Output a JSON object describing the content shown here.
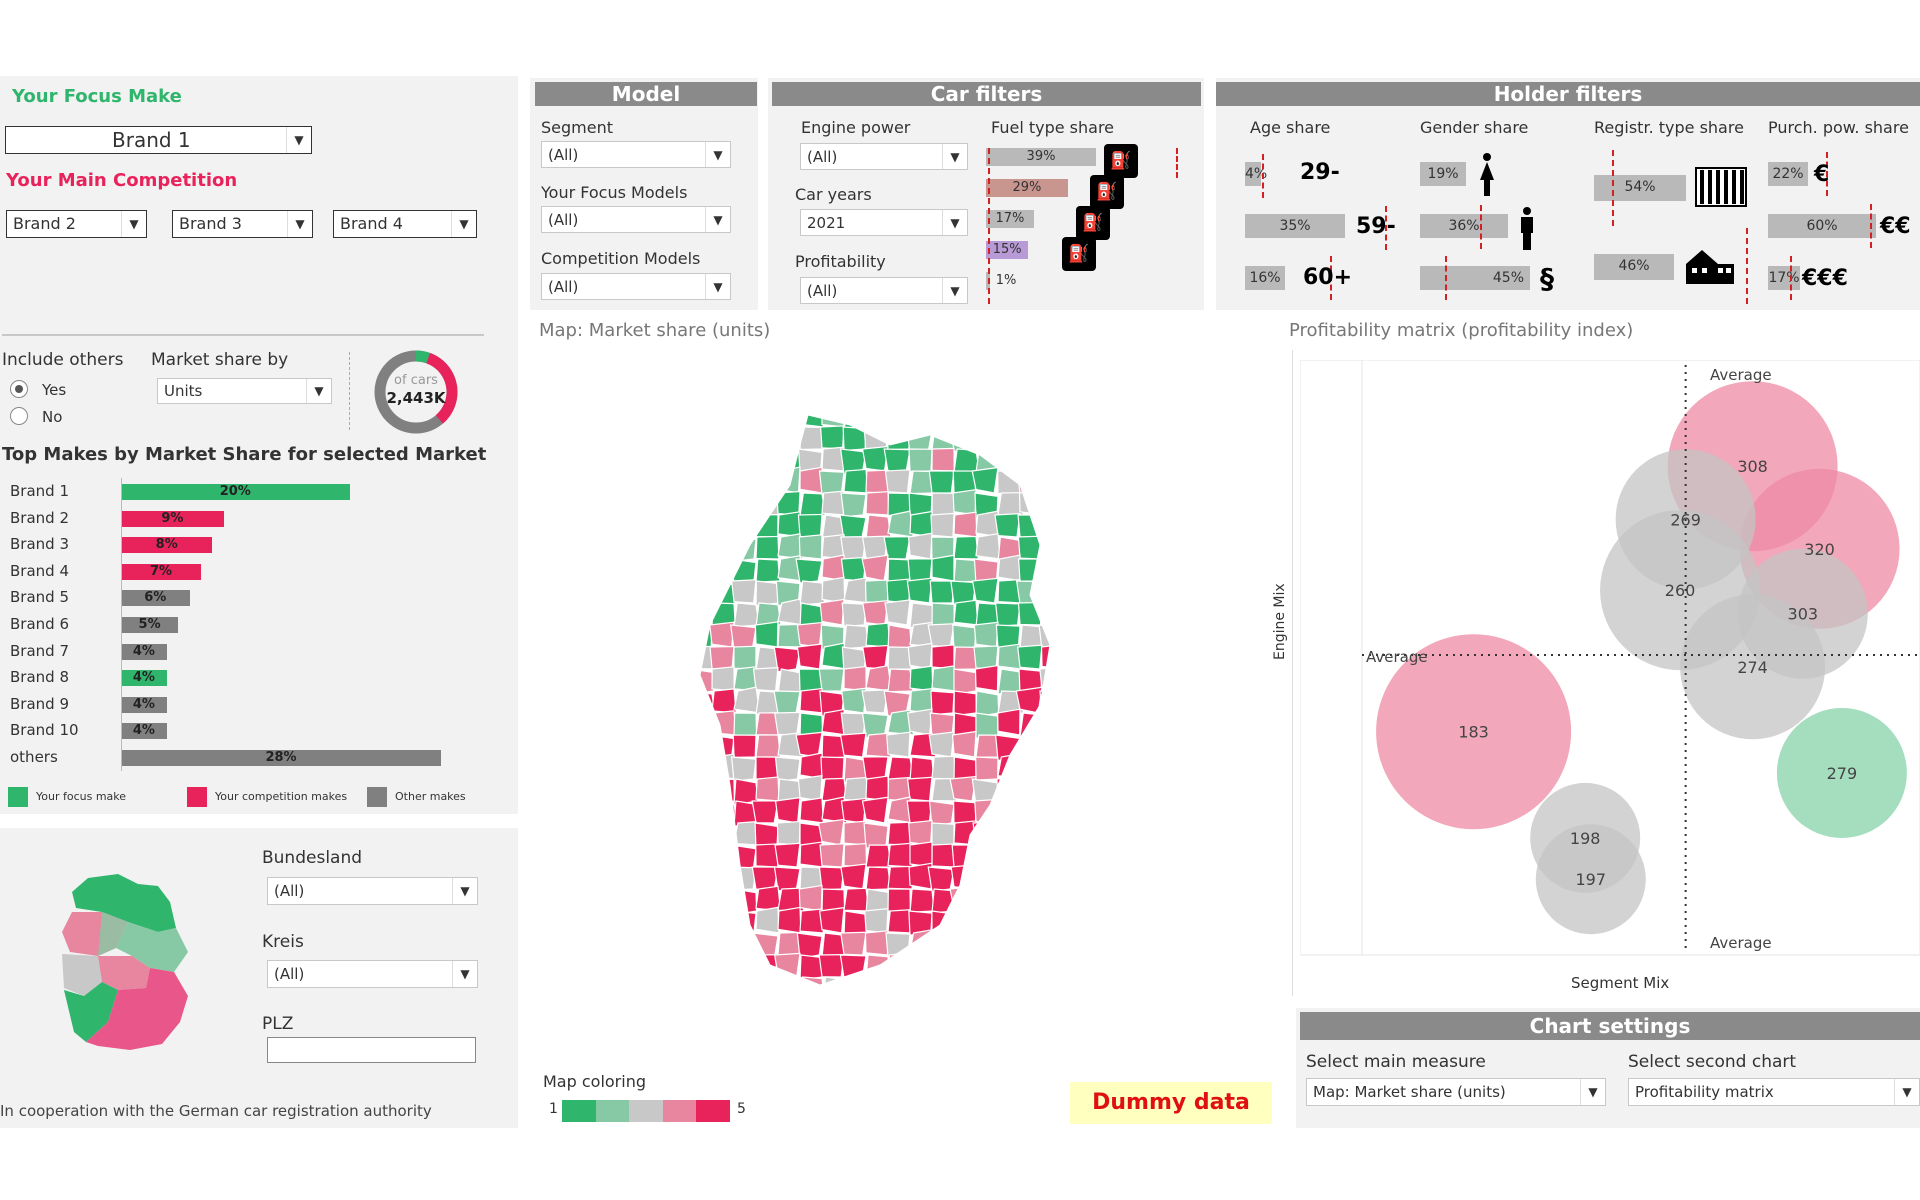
{
  "colors": {
    "focus": "#2fb56c",
    "competition": "#e8235c",
    "other": "#808080",
    "pink": "#e8859f",
    "lightgreen": "#86c9a4",
    "grey": "#c8c8c8"
  },
  "left": {
    "focus_make_label": "Your Focus Make",
    "focus_make_value": "Brand 1",
    "competition_label": "Your Main Competition",
    "competitors": [
      "Brand 2",
      "Brand 3",
      "Brand 4"
    ],
    "include_others_label": "Include others",
    "include_yes": "Yes",
    "include_no": "No",
    "market_share_by_label": "Market share by",
    "market_share_by_value": "Units",
    "donut_line1": "of cars",
    "donut_line2": "2,443K",
    "top_makes_title": "Top Makes by Market Share for selected Market",
    "legend": {
      "focus": "Your focus make",
      "competition": "Your competition makes",
      "other": "Other makes"
    },
    "bundesland_label": "Bundesland",
    "bundesland_value": "(All)",
    "kreis_label": "Kreis",
    "kreis_value": "(All)",
    "plz_label": "PLZ",
    "plz_value": "",
    "footer": "In cooperation with the German car registration authority"
  },
  "top_makes": [
    {
      "name": "Brand 1",
      "pct": 20,
      "label": "20%",
      "group": "focus"
    },
    {
      "name": "Brand 2",
      "pct": 9,
      "label": "9%",
      "group": "competition"
    },
    {
      "name": "Brand 3",
      "pct": 8,
      "label": "8%",
      "group": "competition"
    },
    {
      "name": "Brand 4",
      "pct": 7,
      "label": "7%",
      "group": "competition"
    },
    {
      "name": "Brand 5",
      "pct": 6,
      "label": "6%",
      "group": "other"
    },
    {
      "name": "Brand 6",
      "pct": 5,
      "label": "5%",
      "group": "other"
    },
    {
      "name": "Brand 7",
      "pct": 4,
      "label": "4%",
      "group": "other"
    },
    {
      "name": "Brand 8",
      "pct": 4,
      "label": "4%",
      "group": "focus"
    },
    {
      "name": "Brand 9",
      "pct": 4,
      "label": "4%",
      "group": "other"
    },
    {
      "name": "Brand 10",
      "pct": 4,
      "label": "4%",
      "group": "other"
    },
    {
      "name": "others",
      "pct": 28,
      "label": "28%",
      "group": "other"
    }
  ],
  "model": {
    "title": "Model",
    "segment_label": "Segment",
    "segment_value": "(All)",
    "focus_models_label": "Your Focus Models",
    "focus_models_value": "(All)",
    "competition_models_label": "Competition Models",
    "competition_models_value": "(All)"
  },
  "car_filters": {
    "title": "Car filters",
    "engine_power_label": "Engine power",
    "engine_power_value": "(All)",
    "car_years_label": "Car years",
    "car_years_value": "2021",
    "profitability_label": "Profitability",
    "profitability_value": "(All)",
    "fuel_label": "Fuel type share",
    "fuel": [
      {
        "pct": 39,
        "label": "39%",
        "icon": "G",
        "color": "#b9b9b9"
      },
      {
        "pct": 29,
        "label": "29%",
        "icon": "H",
        "color": "#c9958f"
      },
      {
        "pct": 17,
        "label": "17%",
        "icon": "D",
        "color": "#b9b9b9"
      },
      {
        "pct": 15,
        "label": "15%",
        "icon": "E",
        "color": "#b79ad6"
      },
      {
        "pct": 1,
        "label": "1%",
        "icon": "",
        "color": "#b9b9b9"
      }
    ]
  },
  "holder_filters": {
    "title": "Holder filters",
    "age_label": "Age share",
    "age": [
      {
        "label": "4%",
        "tag": "29-"
      },
      {
        "label": "35%",
        "tag": "59-"
      },
      {
        "label": "16%",
        "tag": "60+"
      }
    ],
    "gender_label": "Gender share",
    "gender": [
      {
        "label": "19%",
        "icon": "female-icon"
      },
      {
        "label": "36%",
        "icon": "male-icon"
      },
      {
        "label": "45%",
        "tag": "§"
      }
    ],
    "registr_label": "Registr. type share",
    "registr": [
      {
        "label": "54%",
        "icon": "office-building-icon"
      },
      {
        "label": "46%",
        "icon": "house-icon"
      }
    ],
    "purch_label": "Purch. pow. share",
    "purch": [
      {
        "label": "22%",
        "tag": "€"
      },
      {
        "label": "60%",
        "tag": "€€"
      },
      {
        "label": "17%",
        "tag": "€€€"
      }
    ]
  },
  "map": {
    "title": "Map: Market share (units)",
    "coloring_label": "Map coloring",
    "scale_min": "1",
    "scale_max": "5",
    "dummy": "Dummy data"
  },
  "matrix": {
    "title": "Profitability matrix (profitability index)",
    "xlabel": "Segment Mix",
    "ylabel": "Engine Mix",
    "avg_label": "Average"
  },
  "chart_settings": {
    "title": "Chart settings",
    "main_label": "Select main measure",
    "main_value": "Map: Market share (units)",
    "second_label": "Select second chart",
    "second_value": "Profitability matrix"
  },
  "chart_data": [
    {
      "type": "bar",
      "title": "Top Makes by Market Share for selected Market",
      "categories": [
        "Brand 1",
        "Brand 2",
        "Brand 3",
        "Brand 4",
        "Brand 5",
        "Brand 6",
        "Brand 7",
        "Brand 8",
        "Brand 9",
        "Brand 10",
        "others"
      ],
      "values": [
        20,
        9,
        8,
        7,
        6,
        5,
        4,
        4,
        4,
        4,
        28
      ]
    },
    {
      "type": "scatter",
      "title": "Profitability matrix (profitability index)",
      "xlabel": "Segment Mix",
      "ylabel": "Engine Mix",
      "points": [
        {
          "x": 0.7,
          "y": 0.82,
          "size": 130,
          "value": "308",
          "color": "#ee8aa4"
        },
        {
          "x": 0.82,
          "y": 0.68,
          "size": 120,
          "value": "320",
          "color": "#ee8aa4"
        },
        {
          "x": 0.58,
          "y": 0.73,
          "size": 100,
          "value": "269",
          "color": "#c4c4c4"
        },
        {
          "x": 0.57,
          "y": 0.61,
          "size": 120,
          "value": "260",
          "color": "#c4c4c4"
        },
        {
          "x": 0.79,
          "y": 0.57,
          "size": 90,
          "value": "303",
          "color": "#c4c4c4"
        },
        {
          "x": 0.7,
          "y": 0.48,
          "size": 105,
          "value": "274",
          "color": "#c4c4c4"
        },
        {
          "x": 0.2,
          "y": 0.37,
          "size": 155,
          "value": "183",
          "color": "#ee8aa4"
        },
        {
          "x": 0.86,
          "y": 0.3,
          "size": 90,
          "value": "279",
          "color": "#86d3a8"
        },
        {
          "x": 0.4,
          "y": 0.19,
          "size": 70,
          "value": "198",
          "color": "#c4c4c4"
        },
        {
          "x": 0.41,
          "y": 0.12,
          "size": 70,
          "value": "197",
          "color": "#c4c4c4"
        }
      ],
      "x_average": 0.58,
      "y_average": 0.5
    }
  ]
}
